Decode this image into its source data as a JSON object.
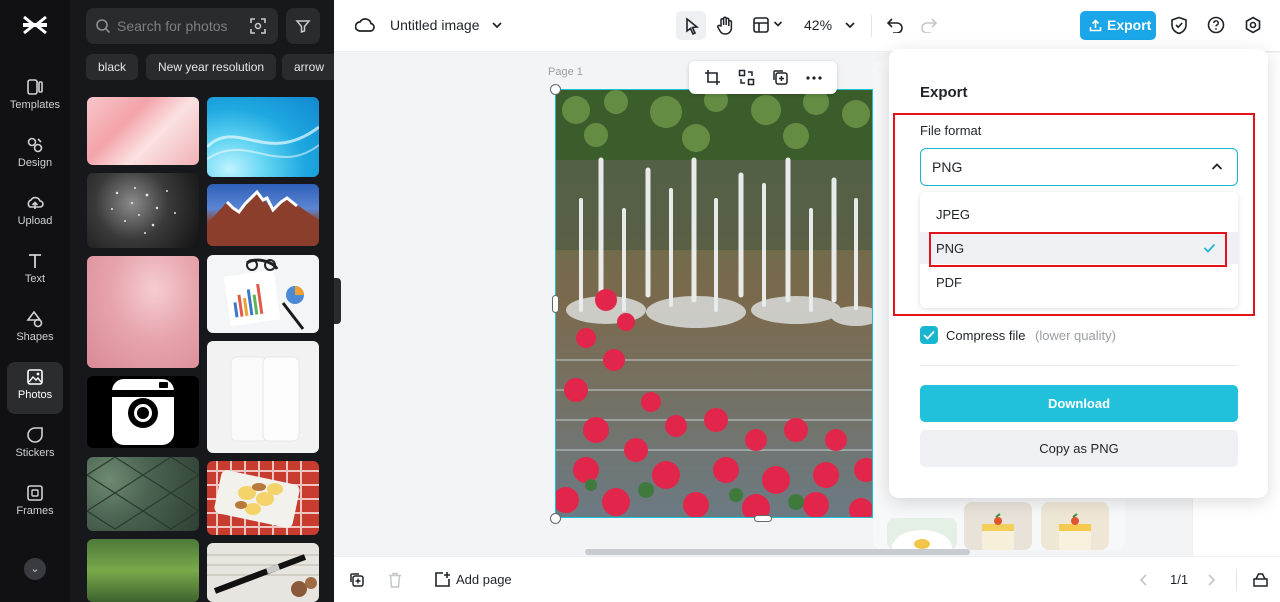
{
  "sidebar": {
    "items": [
      {
        "label": "Templates",
        "icon": "templates-icon"
      },
      {
        "label": "Design",
        "icon": "design-icon"
      },
      {
        "label": "Upload",
        "icon": "upload-icon"
      },
      {
        "label": "Text",
        "icon": "text-icon"
      },
      {
        "label": "Shapes",
        "icon": "shapes-icon"
      },
      {
        "label": "Photos",
        "icon": "photos-icon",
        "active": true
      },
      {
        "label": "Stickers",
        "icon": "stickers-icon"
      },
      {
        "label": "Frames",
        "icon": "frames-icon"
      }
    ]
  },
  "photos_panel": {
    "search_placeholder": "Search for photos",
    "chips": [
      "black",
      "New year resolution",
      "arrow"
    ]
  },
  "header": {
    "title": "Untitled image",
    "zoom": "42%",
    "export_label": "Export"
  },
  "canvas": {
    "page_label": "Page 1"
  },
  "export_popover": {
    "title": "Export",
    "file_format_label": "File format",
    "selected_format": "PNG",
    "options": [
      "JPEG",
      "PNG",
      "PDF"
    ],
    "compress_label": "Compress file",
    "compress_note": "(lower quality)",
    "compress_checked": true,
    "download_label": "Download",
    "copy_label": "Copy as PNG"
  },
  "footer": {
    "add_page_label": "Add page",
    "page_counter": "1/1"
  },
  "colors": {
    "accent": "#21c1dc",
    "export_button": "#1aa6e8",
    "highlight_box": "#e3121b"
  }
}
